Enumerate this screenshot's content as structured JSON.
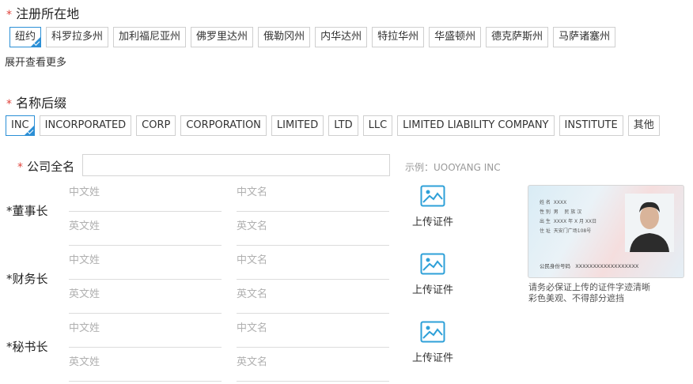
{
  "registration": {
    "required_mark": "*",
    "title": "注册所在地",
    "states": [
      "纽约",
      "科罗拉多州",
      "加利福尼亚州",
      "佛罗里达州",
      "俄勒冈州",
      "内华达州",
      "特拉华州",
      "华盛顿州",
      "德克萨斯州",
      "马萨诸塞州"
    ],
    "selected": "纽约",
    "more_label": "展开查看更多"
  },
  "suffix": {
    "required_mark": "*",
    "title": "名称后缀",
    "options": [
      "INC",
      "INCORPORATED",
      "CORP",
      "CORPORATION",
      "LIMITED",
      "LTD",
      "LLC",
      "LIMITED LIABILITY COMPANY",
      "INSTITUTE",
      "其他"
    ],
    "selected": "INC"
  },
  "fullname": {
    "required_mark": "*",
    "label": "公司全名",
    "value": "",
    "hint": "示例：UOOYANG INC"
  },
  "officers": [
    {
      "label": "*董事长",
      "cn_last": "中文姓",
      "cn_first": "中文名",
      "en_last": "英文姓",
      "en_first": "英文名",
      "upload": "上传证件"
    },
    {
      "label": "*财务长",
      "cn_last": "中文姓",
      "cn_first": "中文名",
      "en_last": "英文姓",
      "en_first": "英文名",
      "upload": "上传证件"
    },
    {
      "label": "*秘书长",
      "cn_last": "中文姓",
      "cn_first": "中文名",
      "en_last": "英文姓",
      "en_first": "英文名",
      "upload": "上传证件"
    }
  ],
  "id_sample": {
    "name_label": "姓 名",
    "name_value": "XXXX",
    "sex_label": "性 别",
    "sex_value": "男",
    "ethnic_label": "民 族",
    "ethnic_value": "汉",
    "birth_label": "出 生",
    "birth_value": "XXXX 年 X 月 XX日",
    "address_label": "住 址",
    "address_value": "天安门广场108号",
    "idno_label": "公民身份号码",
    "idno_value": "XXXXXXXXXXXXXXXXXX",
    "note_line1": "请务必保证上传的证件字迹清晰",
    "note_line2": "彩色美观、不得部分遮挡"
  },
  "colors": {
    "accent": "#2b8fd6",
    "required": "#e0443c",
    "icon_blue": "#2ea0d8"
  }
}
